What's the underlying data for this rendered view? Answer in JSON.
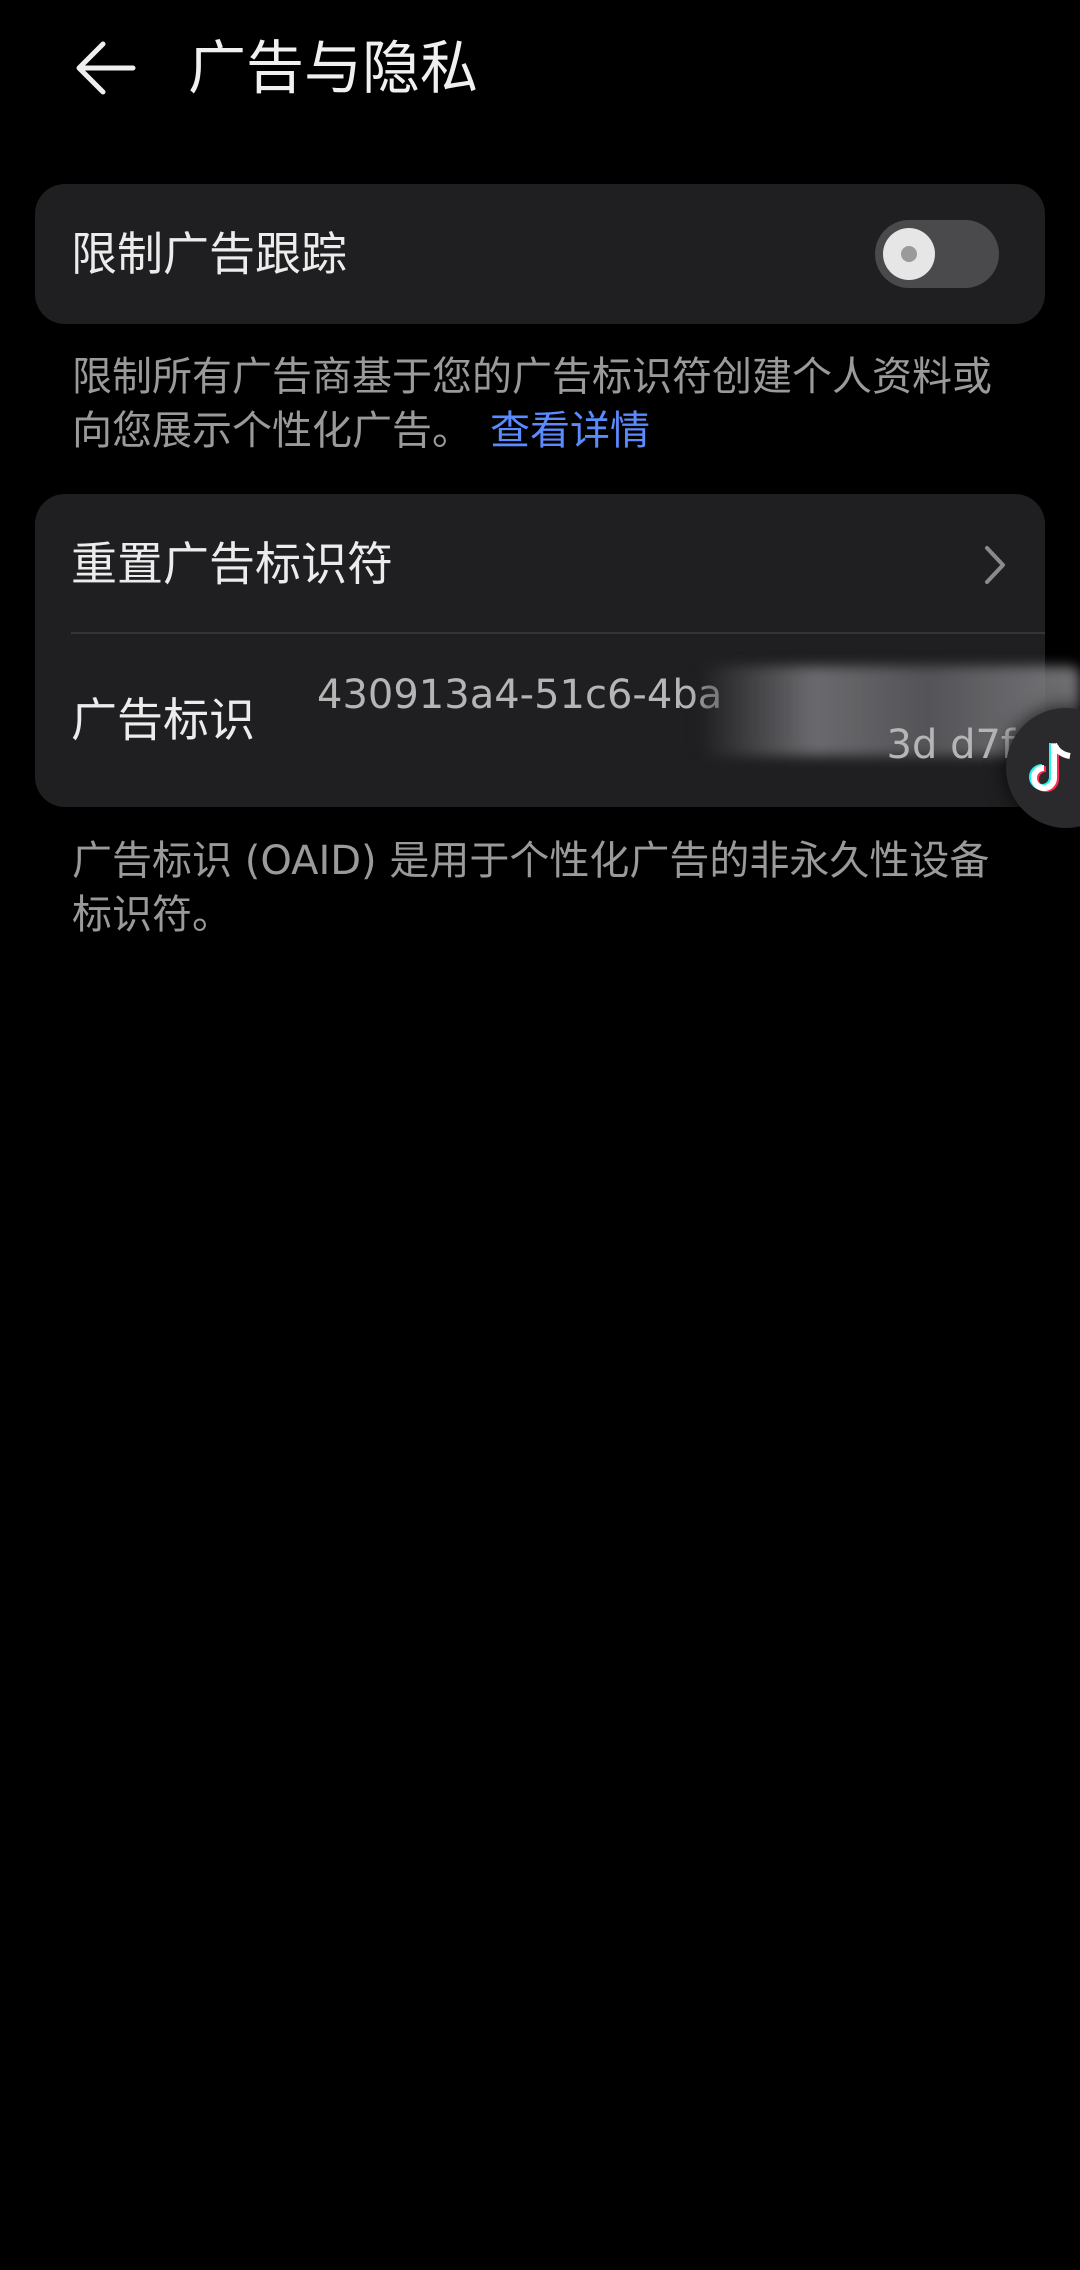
{
  "header": {
    "title": "广告与隐私",
    "back_icon": "arrow-left-icon"
  },
  "limit_tracking": {
    "label": "限制广告跟踪",
    "toggle_on": false,
    "description": "限制所有广告商基于您的广告标识符创建个人资料或向您展示个性化广告。",
    "link_label": "查看详情"
  },
  "identifier_card": {
    "reset_label": "重置广告标识符",
    "chevron_icon": "chevron-right-icon",
    "id_label": "广告标识",
    "id_value_line1": "430913a4-51c6-4ba",
    "id_value_line2": "3d d7f"
  },
  "oaid_description": "广告标识 (OAID) 是用于个性化广告的非永久性设备标识符。",
  "colors": {
    "background": "#000000",
    "card": "#1f1f21",
    "link": "#5b8bff",
    "secondary_text": "#9a9a9a"
  },
  "floating_icon": "tiktok-icon"
}
